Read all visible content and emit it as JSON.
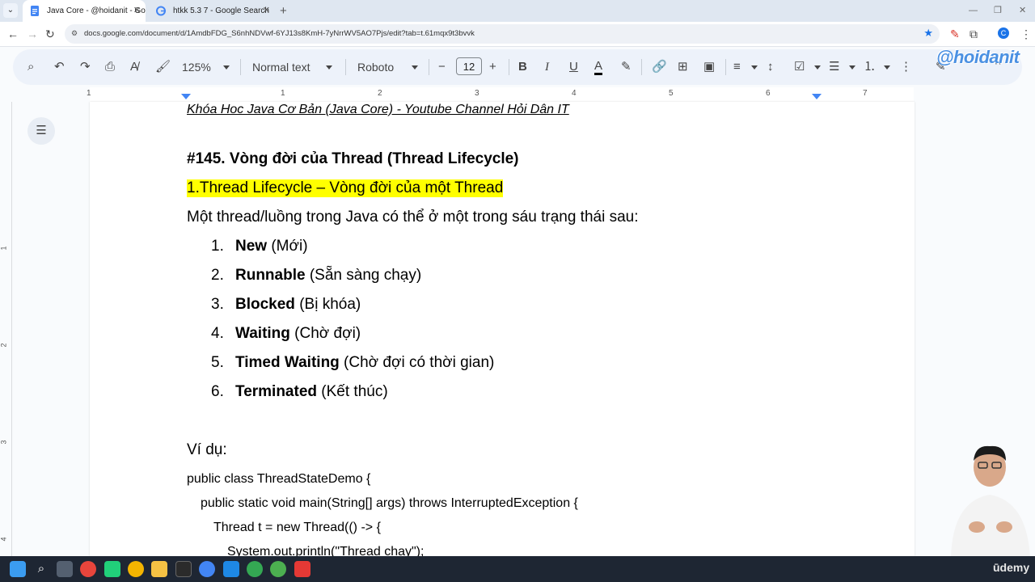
{
  "browser": {
    "tabs": [
      {
        "title": "Java Core - @hoidanit - Googl",
        "active": true
      },
      {
        "title": "htkk 5.3 7 - Google Search",
        "active": false
      }
    ],
    "new_tab": "+",
    "url": "docs.google.com/document/d/1AmdbFDG_S6nhNDVwf-6YJ13s8KmH-7yNrrWV5AO7Pjs/edit?tab=t.61mqx9t3bvvk",
    "profile_initial": "C"
  },
  "toolbar": {
    "zoom": "125%",
    "style": "Normal text",
    "font": "Roboto",
    "font_size": "12",
    "bold": "B",
    "italic": "I",
    "underline": "U",
    "text_color": "A"
  },
  "watermark": "@hoidanit",
  "ruler": {
    "numbers": [
      "1",
      "1",
      "2",
      "3",
      "4",
      "5",
      "6",
      "7"
    ],
    "vertical_numbers": [
      "1",
      "2",
      "3",
      "4"
    ]
  },
  "document": {
    "header": "Khóa Hoc Java Cơ Bản (Java Core)  - Youtube Channel Hỏi Dân IT",
    "title": "#145. Vòng đời của Thread (Thread Lifecycle)",
    "section": "1.Thread Lifecycle – Vòng đời của một Thread",
    "intro": "Một thread/luồng trong Java có thể ở một trong sáu trạng thái sau:",
    "states": [
      {
        "num": "1.",
        "name": "New",
        "desc": " (Mới)"
      },
      {
        "num": "2.",
        "name": "Runnable",
        "desc": " (Sẵn sàng chạy)"
      },
      {
        "num": "3.",
        "name": "Blocked",
        "desc": " (Bị khóa)"
      },
      {
        "num": "4.",
        "name": "Waiting",
        "desc": " (Chờ đợi)"
      },
      {
        "num": "5.",
        "name": "Timed Waiting",
        "desc": " (Chờ đợi có thời gian)"
      },
      {
        "num": "6.",
        "name": "Terminated",
        "desc": " (Kết thúc)"
      }
    ],
    "example_label": "Ví dụ:",
    "code": [
      "public class ThreadStateDemo {",
      "public static void main(String[] args) throws InterruptedException {",
      "Thread t = new Thread(() -> {",
      "System.out.println(\"Thread chạy\");"
    ]
  },
  "branding": {
    "udemy": "ūdemy"
  }
}
